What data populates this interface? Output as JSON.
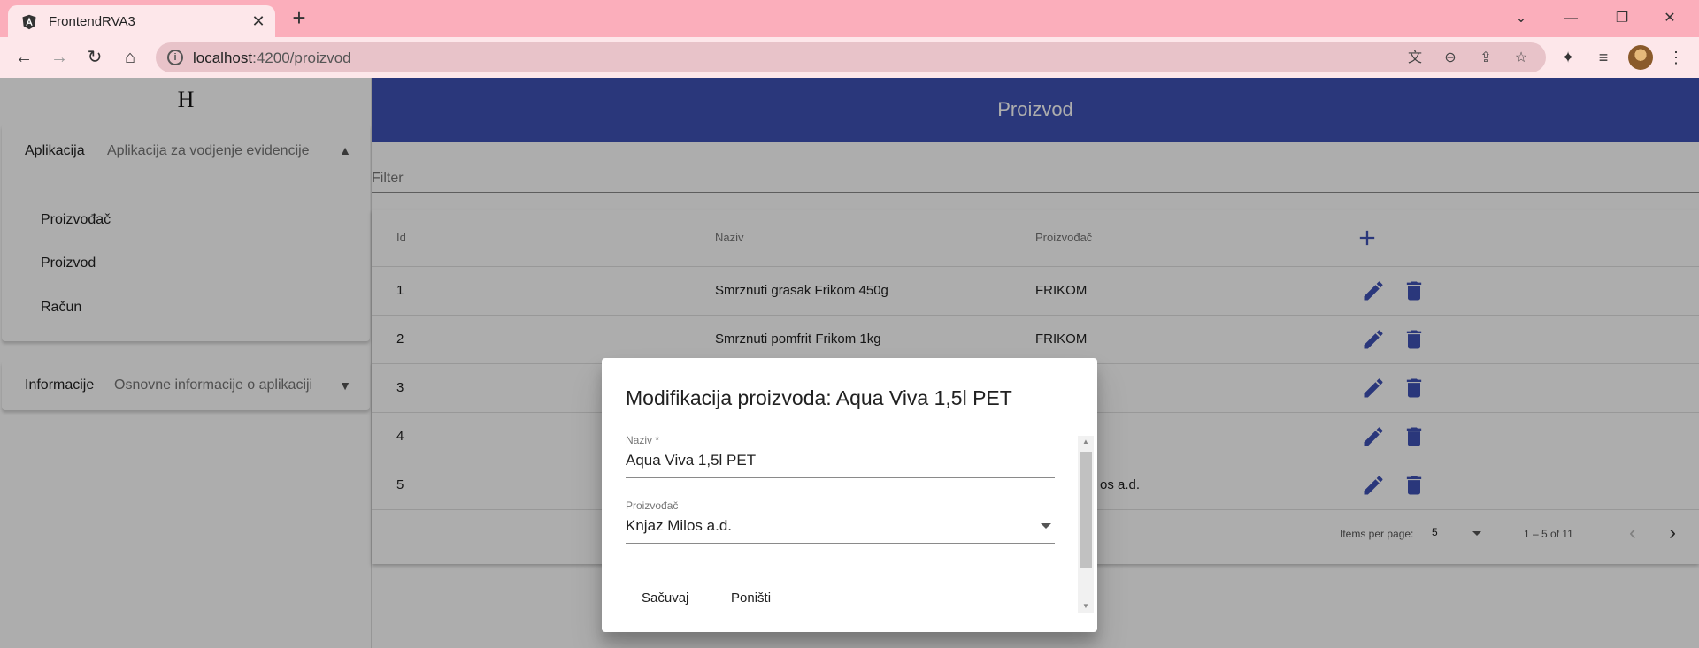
{
  "browser": {
    "tab_title": "FrontendRVA3",
    "url_host": "localhost",
    "url_path": ":4200/proizvod"
  },
  "sidebar": {
    "logo": "H",
    "panels": [
      {
        "title": "Aplikacija",
        "description": "Aplikacija za vodjenje evidencije",
        "expanded": true,
        "links": [
          "Proizvođač",
          "Proizvod",
          "Račun"
        ]
      },
      {
        "title": "Informacije",
        "description": "Osnovne informacije o aplikaciji",
        "expanded": false
      }
    ]
  },
  "page": {
    "title": "Proizvod",
    "filter_placeholder": "Filter"
  },
  "table": {
    "columns": [
      "Id",
      "Naziv",
      "Proizvođač"
    ],
    "rows": [
      {
        "id": "1",
        "naziv": "Smrznuti grasak Frikom 450g",
        "proizvodjac": "FRIKOM"
      },
      {
        "id": "2",
        "naziv": "Smrznuti pomfrit Frikom 1kg",
        "proizvodjac": "FRIKOM"
      },
      {
        "id": "3",
        "naziv": "",
        "proizvodjac": ""
      },
      {
        "id": "4",
        "naziv": "",
        "proizvodjac": ""
      },
      {
        "id": "5",
        "naziv": "",
        "proizvodjac": "os a.d."
      }
    ]
  },
  "paginator": {
    "items_per_page_label": "Items per page:",
    "page_size": "5",
    "range_label": "1 – 5 of 11"
  },
  "dialog": {
    "title": "Modifikacija proizvoda: Aqua Viva 1,5l PET",
    "naziv_label": "Naziv *",
    "naziv_value": "Aqua Viva 1,5l PET",
    "proizvodjac_label": "Proizvođač",
    "proizvodjac_value": "Knjaz Milos a.d.",
    "save_label": "Sačuvaj",
    "cancel_label": "Poništi"
  },
  "colors": {
    "primary": "#3f51b5",
    "tab_strip": "#fbaebb",
    "toolbar": "#fde7ea"
  }
}
